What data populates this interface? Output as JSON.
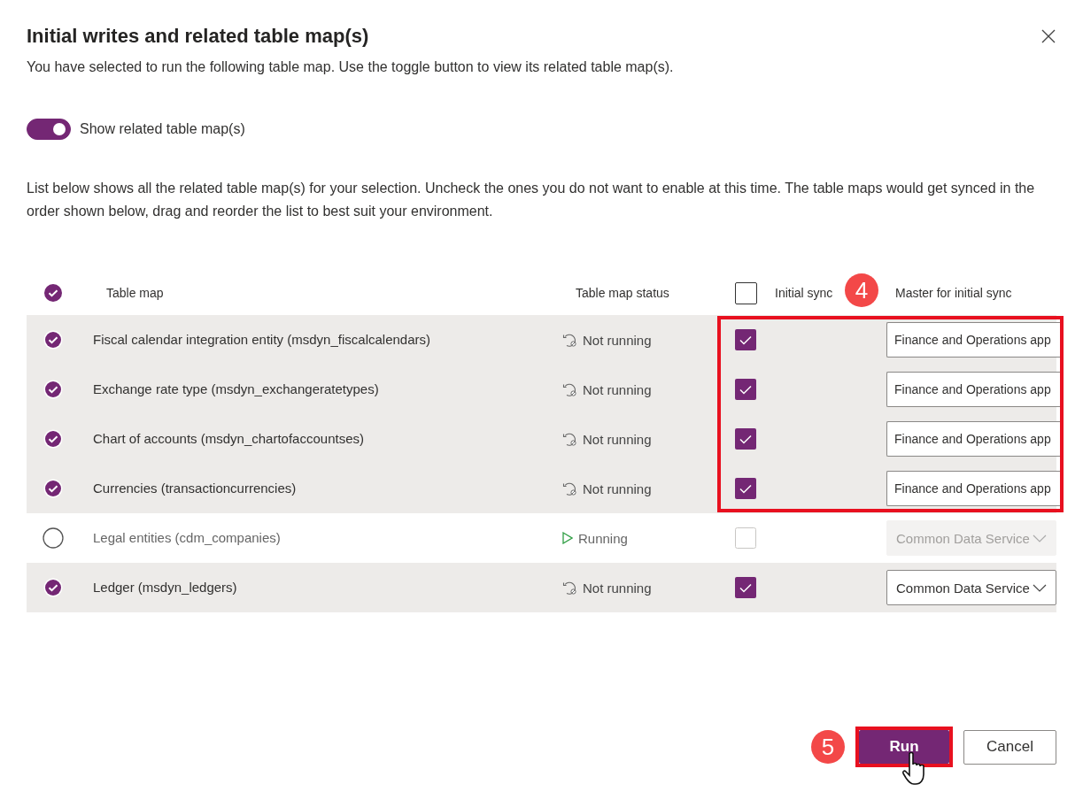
{
  "dialog": {
    "title": "Initial writes and related table map(s)",
    "subtitle": "You have selected to run the following table map. Use the toggle button to view its related table map(s).",
    "toggle": {
      "label": "Show related table map(s)",
      "on": true
    },
    "description": "List below shows all the related table map(s) for your selection. Uncheck the ones you do not want to enable at this time. The table maps would get synced in the order shown below, drag and reorder the list to best suit your environment.",
    "table": {
      "all_selected": true,
      "columns": [
        "Table map",
        "Table map status",
        "Initial sync",
        "Master for initial sync"
      ],
      "initial_sync_all_checked": false,
      "rows": [
        {
          "selected": true,
          "name": "Fiscal calendar integration entity (msdyn_fiscalcalendars)",
          "status": {
            "kind": "not_running",
            "label": "Not running"
          },
          "initial_sync": true,
          "master": {
            "value": "Finance and Operations app",
            "truncated": true,
            "disabled": false
          }
        },
        {
          "selected": true,
          "name": "Exchange rate type (msdyn_exchangeratetypes)",
          "status": {
            "kind": "not_running",
            "label": "Not running"
          },
          "initial_sync": true,
          "master": {
            "value": "Finance and Operations app",
            "truncated": true,
            "disabled": false
          }
        },
        {
          "selected": true,
          "name": "Chart of accounts (msdyn_chartofaccountses)",
          "status": {
            "kind": "not_running",
            "label": "Not running"
          },
          "initial_sync": true,
          "master": {
            "value": "Finance and Operations app",
            "truncated": true,
            "disabled": false
          }
        },
        {
          "selected": true,
          "name": "Currencies (transactioncurrencies)",
          "status": {
            "kind": "not_running",
            "label": "Not running"
          },
          "initial_sync": true,
          "master": {
            "value": "Finance and Operations app",
            "truncated": true,
            "disabled": false
          }
        },
        {
          "selected": false,
          "name": "Legal entities (cdm_companies)",
          "status": {
            "kind": "running",
            "label": "Running"
          },
          "initial_sync": false,
          "master": {
            "value": "Common Data Service",
            "truncated": false,
            "disabled": true
          }
        },
        {
          "selected": true,
          "name": "Ledger (msdyn_ledgers)",
          "status": {
            "kind": "not_running",
            "label": "Not running"
          },
          "initial_sync": true,
          "master": {
            "value": "Common Data Service",
            "truncated": false,
            "disabled": false
          }
        }
      ]
    },
    "buttons": [
      {
        "kind": "primary",
        "label": "Run"
      },
      {
        "kind": "secondary",
        "label": "Cancel"
      }
    ],
    "callouts": [
      {
        "label": "4"
      },
      {
        "label": "5"
      }
    ]
  }
}
